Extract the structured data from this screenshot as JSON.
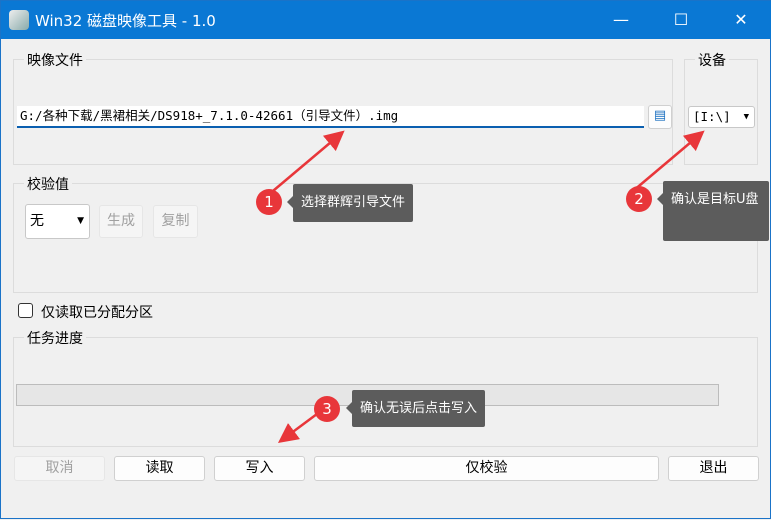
{
  "window": {
    "title": "Win32 磁盘映像工具 - 1.0",
    "minimize": "—",
    "maximize": "☐",
    "close": "✕"
  },
  "image_file": {
    "label": "映像文件",
    "path": "G:/各种下载/黑裙相关/DS918+_7.1.0-42661（引导文件）.img"
  },
  "device": {
    "label": "设备",
    "value": "[I:\\]"
  },
  "hash": {
    "label": "校验值",
    "type": "无",
    "generate": "生成",
    "copy": "复制"
  },
  "readonly_checkbox": {
    "label": "仅读取已分配分区",
    "checked": false
  },
  "progress": {
    "label": "任务进度",
    "value": 0
  },
  "buttons": {
    "cancel": "取消",
    "read": "读取",
    "write": "写入",
    "verify": "仅校验",
    "exit": "退出"
  },
  "annotations": [
    {
      "number": "1",
      "text": "选择群辉引导文件"
    },
    {
      "number": "2",
      "text": "确认是目标U盘"
    },
    {
      "number": "3",
      "text": "确认无误后点击写入"
    }
  ],
  "colors": {
    "titlebar": "#0a78d4",
    "annotation": "#e8363a",
    "tooltip": "#5c5c5c"
  }
}
